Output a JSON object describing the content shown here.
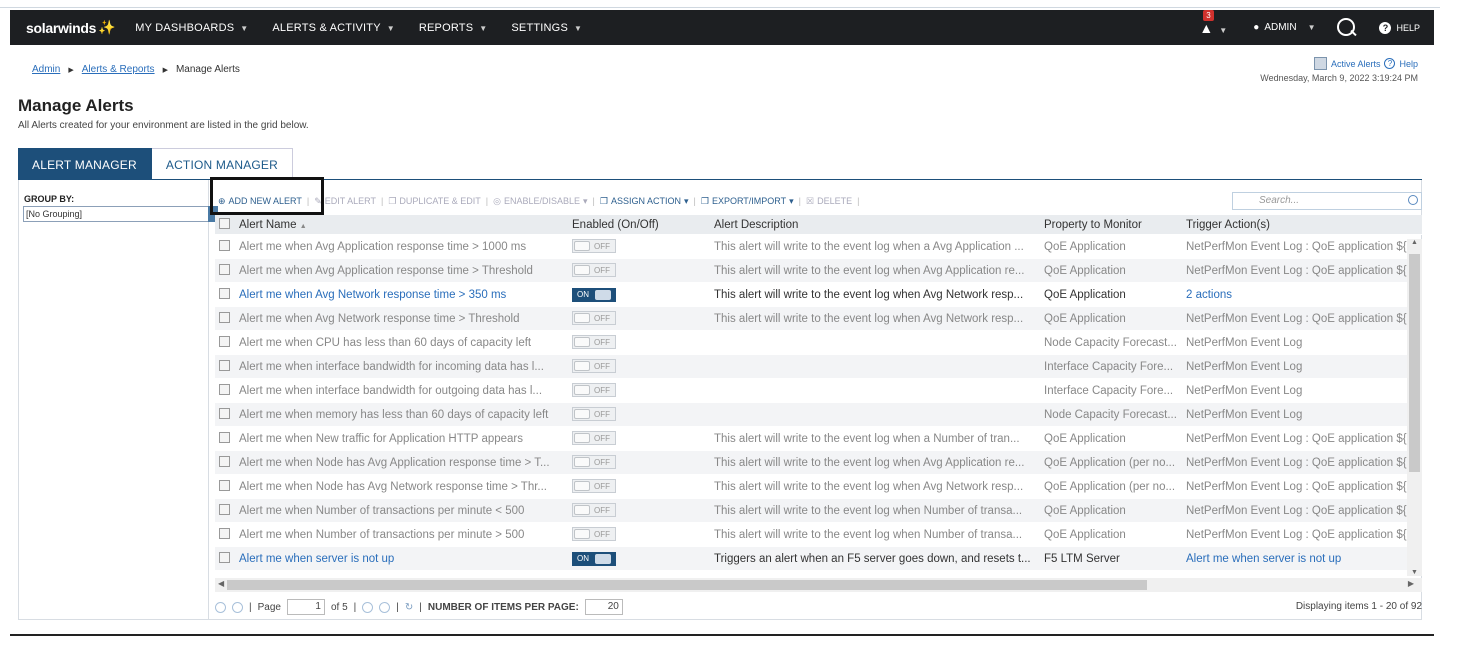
{
  "brand": {
    "name": "solarwinds"
  },
  "nav": {
    "items": [
      "MY DASHBOARDS",
      "ALERTS & ACTIVITY",
      "REPORTS",
      "SETTINGS"
    ],
    "notifications": "3",
    "admin": "ADMIN",
    "help": "HELP"
  },
  "breadcrumb": {
    "items": [
      "Admin",
      "Alerts & Reports",
      "Manage Alerts"
    ]
  },
  "topinfo": {
    "active_alerts": "Active Alerts",
    "help": "Help",
    "datetime": "Wednesday, March 9, 2022 3:19:24 PM"
  },
  "page": {
    "title": "Manage Alerts",
    "subtitle": "All Alerts created for your environment are listed in the grid below."
  },
  "tabs": [
    "ALERT MANAGER",
    "ACTION MANAGER"
  ],
  "groupby": {
    "label": "GROUP BY:",
    "value": "[No Grouping]"
  },
  "toolbar": {
    "add": "ADD NEW ALERT",
    "edit": "EDIT ALERT",
    "duplicate": "DUPLICATE & EDIT",
    "enable": "ENABLE/DISABLE",
    "assign": "ASSIGN ACTION",
    "export": "EXPORT/IMPORT",
    "delete": "DELETE",
    "search_placeholder": "Search..."
  },
  "columns": [
    "Alert Name",
    "Enabled (On/Off)",
    "Alert Description",
    "Property to Monitor",
    "Trigger Action(s)"
  ],
  "rows": [
    {
      "name": "Alert me when Avg Application response time > 1000 ms",
      "enabled": "OFF",
      "desc": "This alert will write to the event log when a Avg Application ...",
      "prop": "QoE Application",
      "trig": "NetPerfMon Event Log : QoE application ${"
    },
    {
      "name": "Alert me when Avg Application response time > Threshold",
      "enabled": "OFF",
      "desc": "This alert will write to the event log when Avg Application re...",
      "prop": "QoE Application",
      "trig": "NetPerfMon Event Log : QoE application ${"
    },
    {
      "name": "Alert me when Avg Network response time > 350 ms",
      "enabled": "ON",
      "desc": "This alert will write to the event log when Avg Network resp...",
      "prop": "QoE Application",
      "trig": "2 actions"
    },
    {
      "name": "Alert me when Avg Network response time > Threshold",
      "enabled": "OFF",
      "desc": "This alert will write to the event log when Avg Network resp...",
      "prop": "QoE Application",
      "trig": "NetPerfMon Event Log : QoE application ${"
    },
    {
      "name": "Alert me when CPU has less than 60 days of capacity left",
      "enabled": "OFF",
      "desc": "",
      "prop": "Node Capacity Forecast...",
      "trig": "NetPerfMon Event Log"
    },
    {
      "name": "Alert me when interface bandwidth for incoming data has l...",
      "enabled": "OFF",
      "desc": "",
      "prop": "Interface Capacity Fore...",
      "trig": "NetPerfMon Event Log"
    },
    {
      "name": "Alert me when interface bandwidth for outgoing data has l...",
      "enabled": "OFF",
      "desc": "",
      "prop": "Interface Capacity Fore...",
      "trig": "NetPerfMon Event Log"
    },
    {
      "name": "Alert me when memory has less than 60 days of capacity left",
      "enabled": "OFF",
      "desc": "",
      "prop": "Node Capacity Forecast...",
      "trig": "NetPerfMon Event Log"
    },
    {
      "name": "Alert me when New traffic for Application HTTP appears",
      "enabled": "OFF",
      "desc": "This alert will write to the event log when a Number of tran...",
      "prop": "QoE Application",
      "trig": "NetPerfMon Event Log : QoE application ${"
    },
    {
      "name": "Alert me when Node has Avg Application response time > T...",
      "enabled": "OFF",
      "desc": "This alert will write to the event log when Avg Application re...",
      "prop": "QoE Application (per no...",
      "trig": "NetPerfMon Event Log : QoE application ${"
    },
    {
      "name": "Alert me when Node has Avg Network response time > Thr...",
      "enabled": "OFF",
      "desc": "This alert will write to the event log when Avg Network resp...",
      "prop": "QoE Application (per no...",
      "trig": "NetPerfMon Event Log : QoE application ${"
    },
    {
      "name": "Alert me when Number of transactions per minute < 500",
      "enabled": "OFF",
      "desc": "This alert will write to the event log when Number of transa...",
      "prop": "QoE Application",
      "trig": "NetPerfMon Event Log : QoE application ${"
    },
    {
      "name": "Alert me when Number of transactions per minute > 500",
      "enabled": "OFF",
      "desc": "This alert will write to the event log when Number of transa...",
      "prop": "QoE Application",
      "trig": "NetPerfMon Event Log : QoE application ${"
    },
    {
      "name": "Alert me when server is not up",
      "enabled": "ON",
      "desc": "Triggers an alert when an F5 server goes down, and resets t...",
      "prop": "F5 LTM Server",
      "trig": "Alert me when server is not up"
    }
  ],
  "pager": {
    "page_label": "Page",
    "page": "1",
    "of": "of 5",
    "items_label": "NUMBER OF ITEMS PER PAGE:",
    "items": "20",
    "display": "Displaying items 1 - 20 of 92"
  }
}
